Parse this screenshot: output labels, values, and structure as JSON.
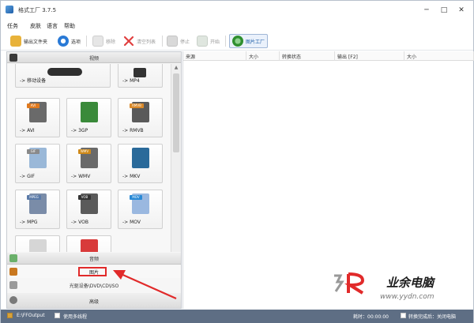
{
  "window": {
    "title": "格式工厂 3.7.5",
    "minimize_glyph": "─",
    "maximize_glyph": "□",
    "close_glyph": "✕"
  },
  "menu": [
    "任务",
    "皮肤",
    "语言",
    "帮助"
  ],
  "toolbar": {
    "output_folder": "输出文件夹",
    "options": "选项",
    "remove": "移除",
    "clear_list": "清空列表",
    "stop": "停止",
    "start": "开始",
    "picture_factory": "图片工厂"
  },
  "left_panel": {
    "video_header": "视频",
    "mobile_device": "-> 移动设备",
    "formats": [
      {
        "label": "-> MP4",
        "tag": "",
        "color": "#333333"
      },
      {
        "label": "-> AVI",
        "tag": "AVI",
        "color": "#e07a1f"
      },
      {
        "label": "-> 3GP",
        "tag": "",
        "color": "#3a8a3a"
      },
      {
        "label": "-> RMVB",
        "tag": "RMVB",
        "color": "#d9892a"
      },
      {
        "label": "-> GIF",
        "tag": "GIF",
        "color": "#8a8a8a"
      },
      {
        "label": "-> WMV",
        "tag": "WMV",
        "color": "#d08a1a"
      },
      {
        "label": "-> MKV",
        "tag": "",
        "color": "#2a6a9a"
      },
      {
        "label": "-> MPG",
        "tag": "MPEG",
        "color": "#5a7aa8"
      },
      {
        "label": "-> VOB",
        "tag": "VOB",
        "color": "#333333"
      },
      {
        "label": "-> MOV",
        "tag": "MOV",
        "color": "#2a8ad6"
      }
    ],
    "audio": "音频",
    "picture": "图片",
    "disc": "光驱设备\\DVD\\CD\\ISO",
    "advanced": "高级"
  },
  "right_panel": {
    "columns": [
      "来源",
      "大小",
      "转换状态",
      "输出 [F2]",
      "大小"
    ]
  },
  "watermark": {
    "brand_cn": "业余电脑",
    "url": "www.yydn.com"
  },
  "status_bar": {
    "output_path": "E:\\FFOutput",
    "multithread": "使用多线程",
    "elapsed_label": "耗时：00:00:00",
    "after_convert": "转换完成后：关闭电脑"
  },
  "colors": {
    "status_bar": "#5e6e84",
    "highlight_red": "#e12a2a"
  }
}
